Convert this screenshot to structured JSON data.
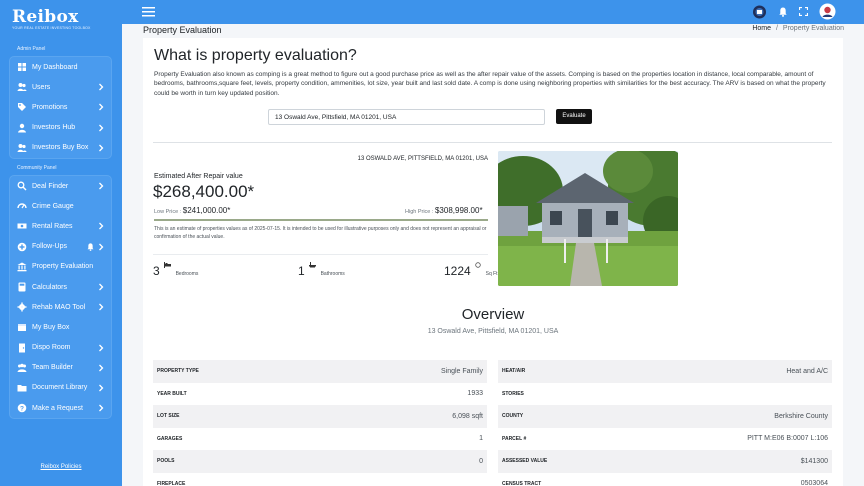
{
  "brand": {
    "name": "Reibox",
    "tagline": "YOUR REAL ESTATE INVESTING TOOLBOX"
  },
  "sidebar": {
    "admin_label": "Admin Panel",
    "community_label": "Community Panel",
    "admin_items": [
      {
        "label": "My Dashboard",
        "icon": "dashboard-icon",
        "has_chevron": false
      },
      {
        "label": "Users",
        "icon": "users-icon",
        "has_chevron": true
      },
      {
        "label": "Promotions",
        "icon": "tag-icon",
        "has_chevron": true
      },
      {
        "label": "Investors Hub",
        "icon": "user-tie-icon",
        "has_chevron": true
      },
      {
        "label": "Investors Buy Box",
        "icon": "users-icon",
        "has_chevron": true
      }
    ],
    "community_items": [
      {
        "label": "Deal Finder",
        "icon": "search-icon",
        "has_chevron": true
      },
      {
        "label": "Crime Gauge",
        "icon": "gauge-icon",
        "has_chevron": false
      },
      {
        "label": "Rental Rates",
        "icon": "money-icon",
        "has_chevron": true
      },
      {
        "label": "Follow-Ups",
        "icon": "plus-icon",
        "has_chevron": true,
        "has_bell": true
      },
      {
        "label": "Property Evaluation",
        "icon": "bank-icon",
        "has_chevron": false
      },
      {
        "label": "Calculators",
        "icon": "calculator-icon",
        "has_chevron": true
      },
      {
        "label": "Rehab MAO Tool",
        "icon": "gear-icon",
        "has_chevron": true
      },
      {
        "label": "My Buy Box",
        "icon": "box-icon",
        "has_chevron": false
      },
      {
        "label": "Dispo Room",
        "icon": "door-icon",
        "has_chevron": true
      },
      {
        "label": "Team Builder",
        "icon": "team-icon",
        "has_chevron": true
      },
      {
        "label": "Document Library",
        "icon": "folder-icon",
        "has_chevron": true
      },
      {
        "label": "Make a Request",
        "icon": "question-icon",
        "has_chevron": true
      }
    ],
    "policies": "Reibox Policies"
  },
  "header": {
    "page_title": "Property Evaluation",
    "breadcrumb_home": "Home",
    "breadcrumb_sep": "/",
    "breadcrumb_current": "Property Evaluation"
  },
  "main": {
    "heading": "What is property evaluation?",
    "description": "Property Evaluation also known as comping is a great method to figure out a good purchase price as well as the after repair value of the assets. Comping is based on the properties location in distance, local comparable, amount of bedrooms, bathrooms,square feet, levels, property condition, ammenities, lot size, year built and last sold date. A comp is done using neighboring properties with similarities for the best accuracy. The ARV is based on what the property could be worth in turn key updated position.",
    "address_value": "13 Oswald Ave, Pittsfield, MA 01201, USA",
    "evaluate_label": "Evaluate"
  },
  "estimate": {
    "full_address": "13 OSWALD AVE, PITTSFIELD, MA 01201, USA",
    "arv_label": "Estimated After Repair value",
    "arv_value": "$268,400.00*",
    "low_label": "Low Price :",
    "low_value": "$241,000.00*",
    "high_label": "High Price :",
    "high_value": "$308,998.00*",
    "disclaimer": "This is an estimate of properties values as of 2025-07-15. It is intended to be used for illustrative purposes only and does not represent an appraisal or confirmation of the actual value.",
    "bedrooms": "3",
    "bedrooms_label": "Bedrooms",
    "bathrooms": "1",
    "bathrooms_label": "Bathrooms",
    "sqft": "1224",
    "sqft_unit": "Sq Ft"
  },
  "overview": {
    "title": "Overview",
    "address": "13 Oswald Ave, Pittsfield, MA 01201, USA",
    "left": [
      {
        "key": "PROPERTY TYPE",
        "value": "Single Family"
      },
      {
        "key": "YEAR BUILT",
        "value": "1933"
      },
      {
        "key": "LOT SIZE",
        "value": "6,098 sqft"
      },
      {
        "key": "GARAGES",
        "value": "1"
      },
      {
        "key": "POOLS",
        "value": "0"
      },
      {
        "key": "FIREPLACE",
        "value": ""
      }
    ],
    "right": [
      {
        "key": "HEAT/AIR",
        "value": "Heat and A/C"
      },
      {
        "key": "STORIES",
        "value": ""
      },
      {
        "key": "COUNTY",
        "value": "Berkshire County"
      },
      {
        "key": "PARCEL #",
        "value": "PITT M:E06 B:0007 L:106"
      },
      {
        "key": "ASSESSED VALUE",
        "value": "$141300"
      },
      {
        "key": "CENSUS TRACT",
        "value": "0503064"
      }
    ]
  }
}
